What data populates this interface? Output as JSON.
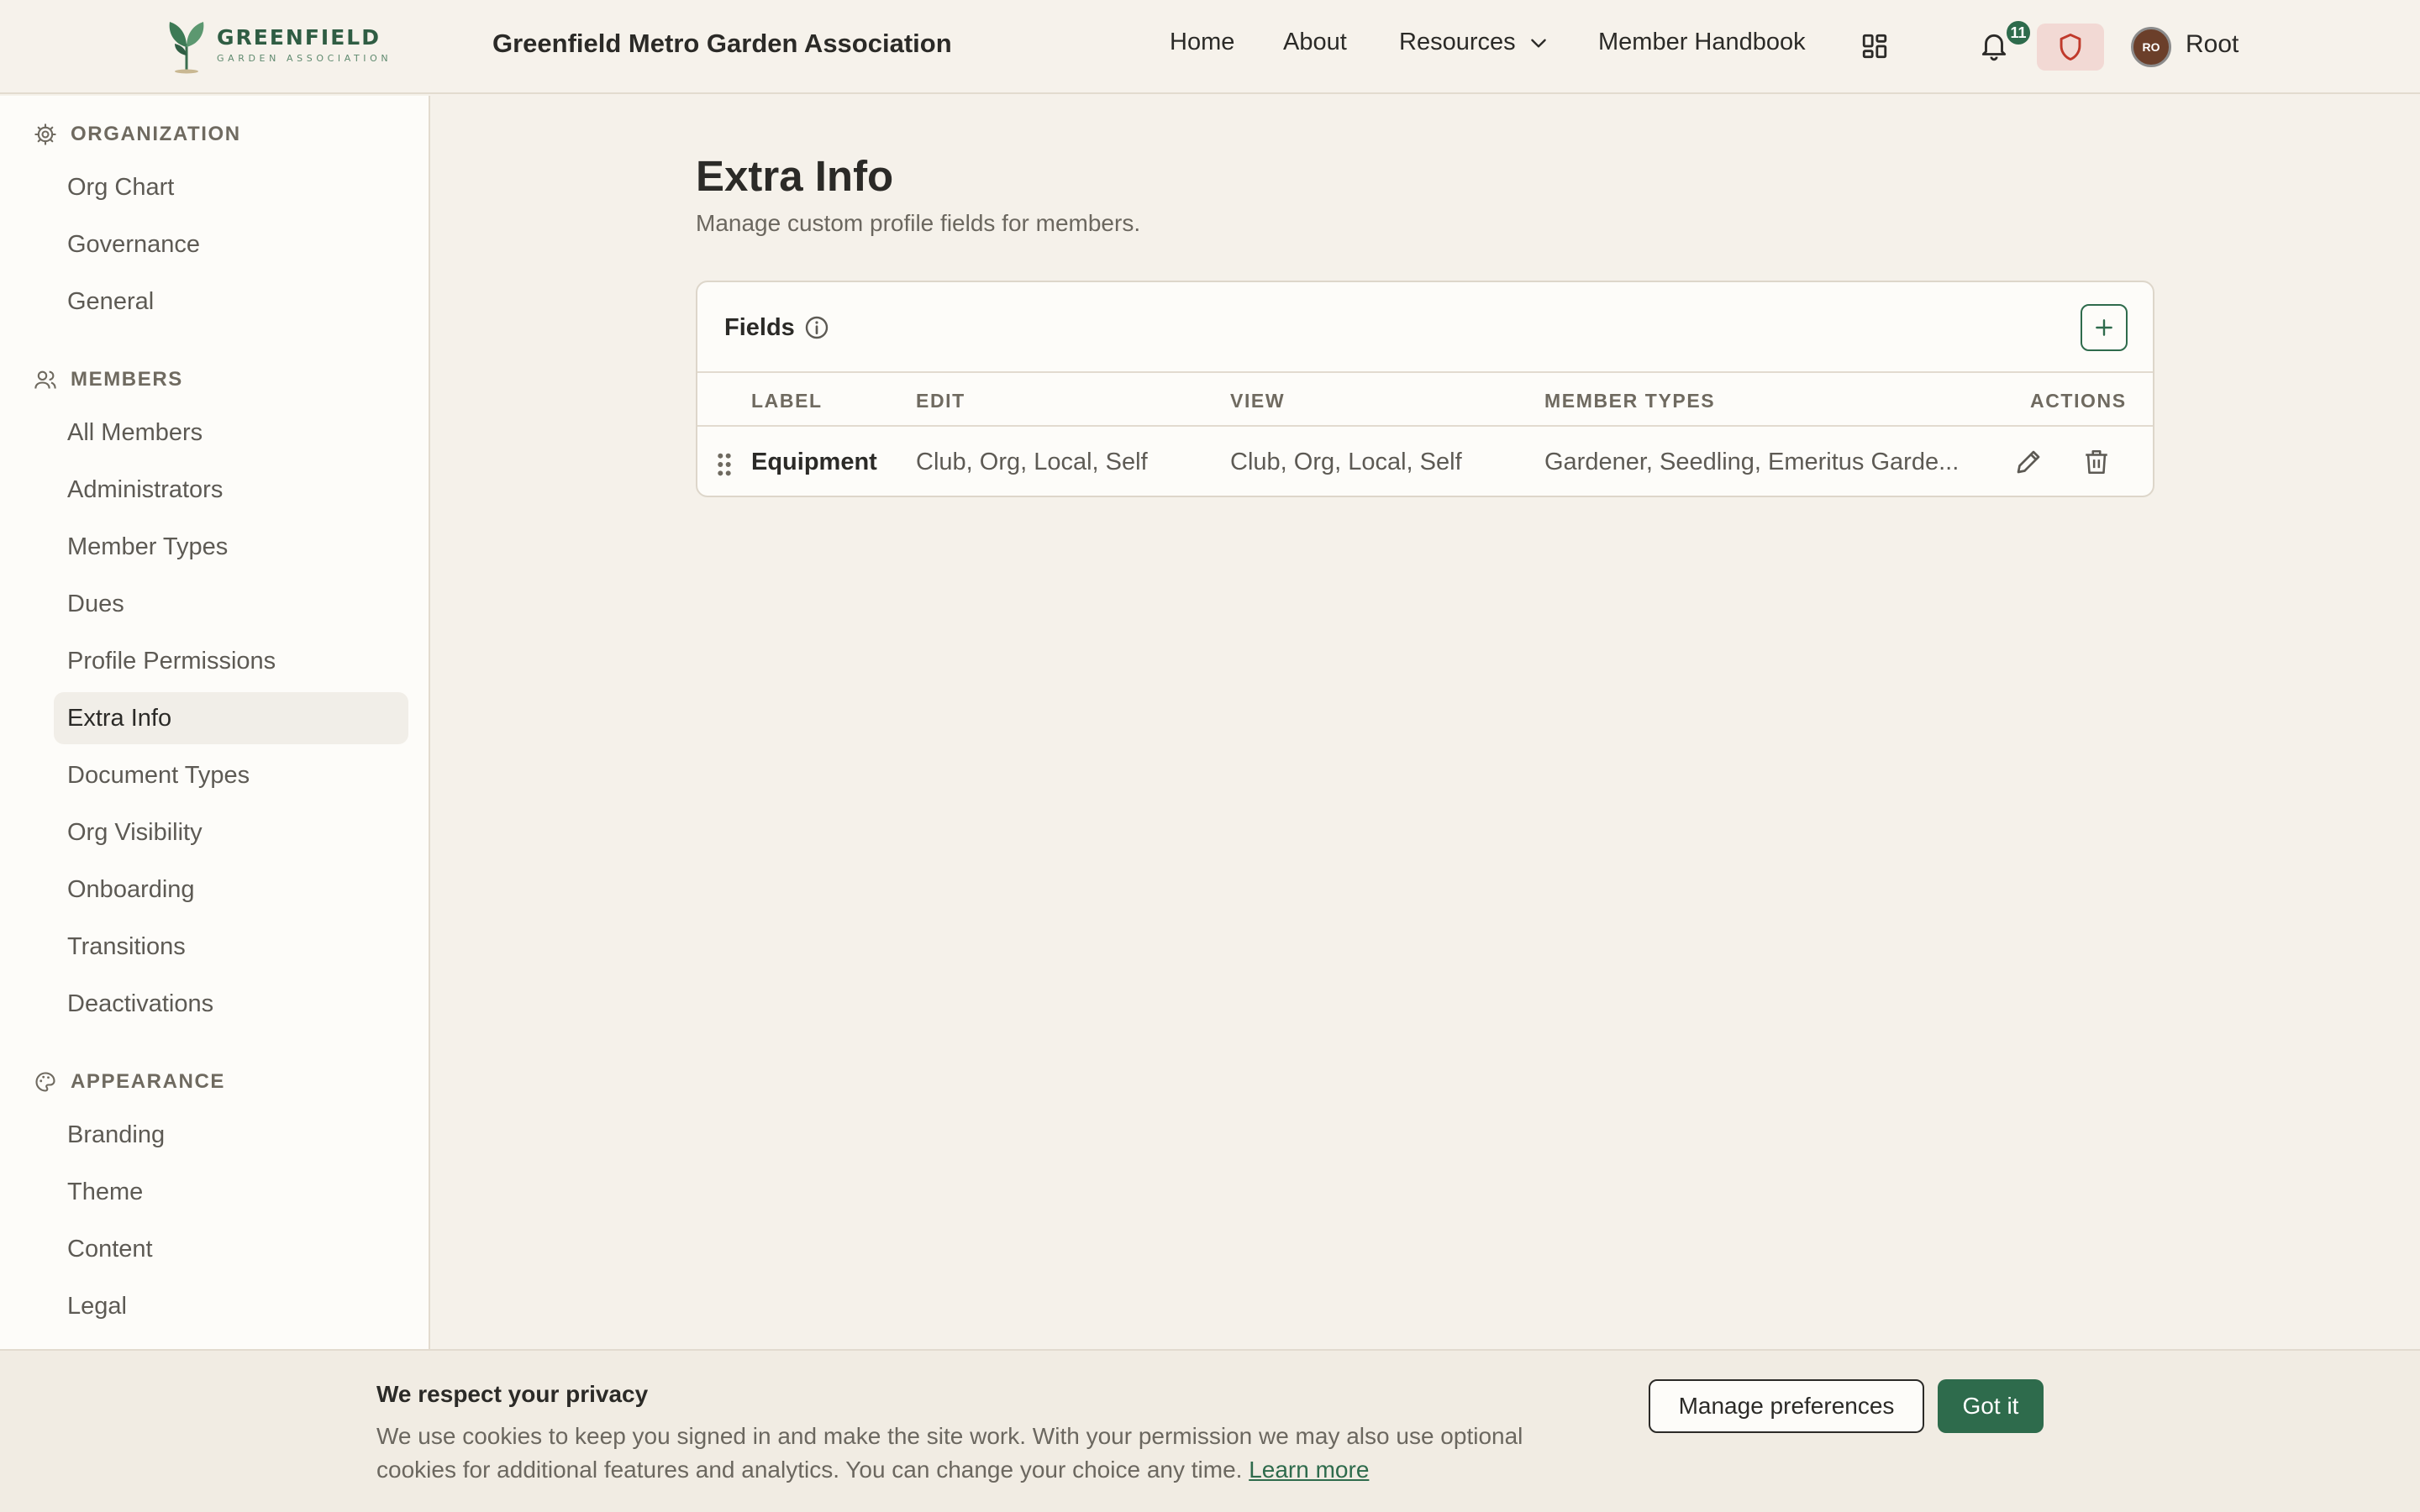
{
  "brand": {
    "logo_name": "GREENFIELD",
    "logo_sub": "GARDEN ASSOCIATION",
    "app_title": "Greenfield Metro Garden Association"
  },
  "nav": {
    "home": "Home",
    "about": "About",
    "resources": "Resources",
    "handbook": "Member Handbook",
    "notification_count": "11",
    "avatar_initials": "RO",
    "user_name": "Root"
  },
  "sidebar": {
    "organization": {
      "heading": "ORGANIZATION",
      "items": [
        "Org Chart",
        "Governance",
        "General"
      ]
    },
    "members": {
      "heading": "MEMBERS",
      "items": [
        "All Members",
        "Administrators",
        "Member Types",
        "Dues",
        "Profile Permissions",
        "Extra Info",
        "Document Types",
        "Org Visibility",
        "Onboarding",
        "Transitions",
        "Deactivations"
      ]
    },
    "appearance": {
      "heading": "APPEARANCE",
      "items": [
        "Branding",
        "Theme",
        "Content",
        "Legal"
      ]
    },
    "active_item": "Extra Info"
  },
  "main": {
    "title": "Extra Info",
    "subtitle": "Manage custom profile fields for members.",
    "card_title": "Fields",
    "columns": {
      "label": "LABEL",
      "edit": "EDIT",
      "view": "VIEW",
      "member_types": "MEMBER TYPES",
      "actions": "ACTIONS"
    },
    "rows": [
      {
        "label": "Equipment",
        "edit": "Club, Org, Local, Self",
        "view": "Club, Org, Local, Self",
        "member_types": "Gardener, Seedling, Emeritus Garde..."
      }
    ]
  },
  "cookie": {
    "title": "We respect your privacy",
    "body": "We use cookies to keep you signed in and make the site work. With your permission we may also use optional cookies for additional features and analytics. You can change your choice any time.",
    "link": "Learn more",
    "manage_button": "Manage preferences",
    "accept_button": "Got it"
  },
  "colors": {
    "accent": "#2e6b4c",
    "background": "#f5f1ea",
    "alert": "#c0392b"
  },
  "icons": [
    "sprout-logo-icon",
    "chevron-down-icon",
    "apps-grid-icon",
    "bell-icon",
    "shield-icon",
    "gear-icon",
    "users-icon",
    "palette-icon",
    "info-icon",
    "plus-icon",
    "drag-handle-icon",
    "pencil-icon",
    "trash-icon"
  ]
}
